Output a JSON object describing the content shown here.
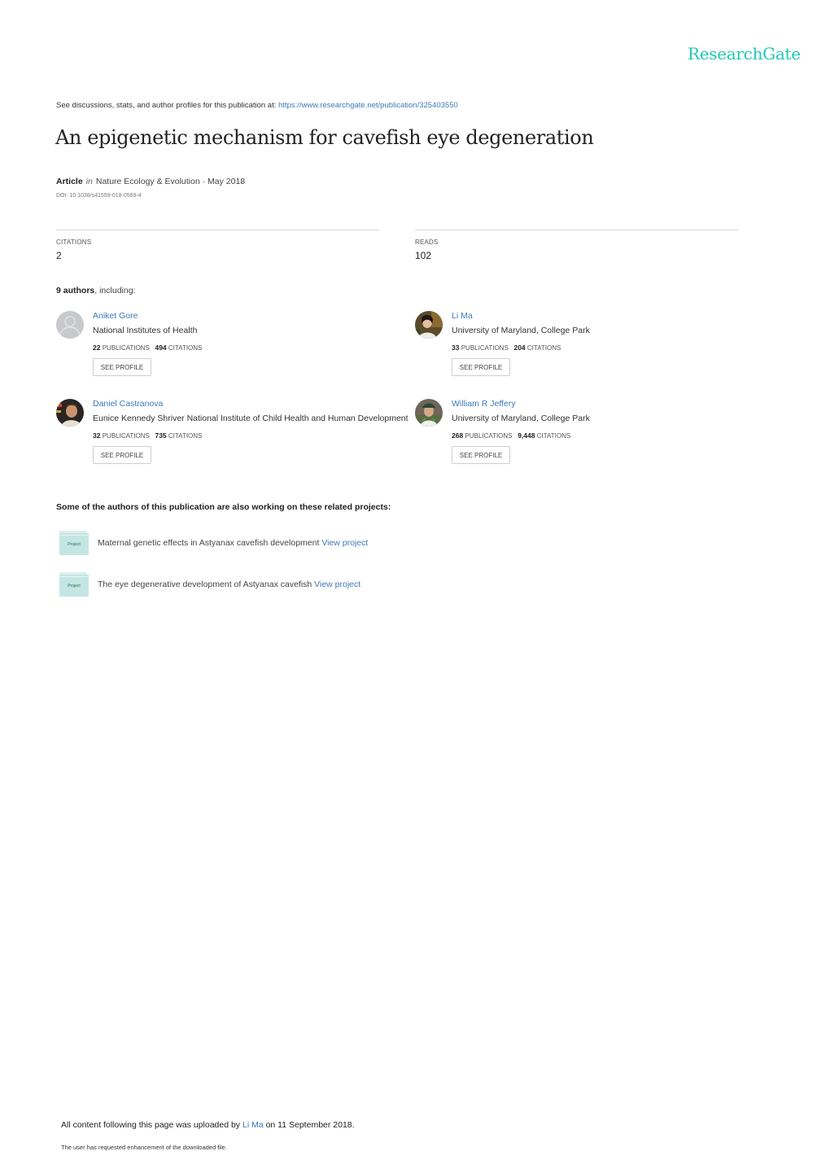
{
  "brand": {
    "logo_text": "ResearchGate",
    "accent_color": "#1ec8b4",
    "link_color": "#3d7ab8"
  },
  "header": {
    "discuss_prefix": "See discussions, stats, and author profiles for this publication at: ",
    "discuss_url": "https://www.researchgate.net/publication/325403550"
  },
  "publication": {
    "title": "An epigenetic mechanism for cavefish eye degeneration",
    "type": "Article",
    "in_word": "in",
    "journal_date": "Nature Ecology & Evolution · May 2018",
    "doi": "DOI: 10.1038/s41559-018-0569-4"
  },
  "stats": {
    "citations_label": "CITATIONS",
    "citations_value": "2",
    "reads_label": "READS",
    "reads_value": "102"
  },
  "authors_section": {
    "count_bold": "9 authors",
    "count_rest": ", including:"
  },
  "authors": [
    {
      "name": "Aniket Gore",
      "institution": "National Institutes of Health",
      "publications": "22",
      "publications_label": "PUBLICATIONS",
      "citations": "494",
      "citations_label": "CITATIONS",
      "button": "SEE PROFILE",
      "avatar": "placeholder-avatar"
    },
    {
      "name": "Li Ma",
      "institution": "University of Maryland, College Park",
      "publications": "33",
      "publications_label": "PUBLICATIONS",
      "citations": "204",
      "citations_label": "CITATIONS",
      "button": "SEE PROFILE",
      "avatar": "photo-avatar"
    },
    {
      "name": "Daniel Castranova",
      "institution": "Eunice Kennedy Shriver National Institute of Child Health and Human Development",
      "publications": "32",
      "publications_label": "PUBLICATIONS",
      "citations": "735",
      "citations_label": "CITATIONS",
      "button": "SEE PROFILE",
      "avatar": "photo-avatar"
    },
    {
      "name": "William R Jeffery",
      "institution": "University of Maryland, College Park",
      "publications": "268",
      "publications_label": "PUBLICATIONS",
      "citations": "9,448",
      "citations_label": "CITATIONS",
      "button": "SEE PROFILE",
      "avatar": "photo-avatar"
    }
  ],
  "related": {
    "heading": "Some of the authors of this publication are also working on these related projects:",
    "projects": [
      {
        "icon_label": "Project",
        "title": "Maternal genetic effects in Astyanax cavefish development",
        "link": "View project"
      },
      {
        "icon_label": "Project",
        "title": "The eye degenerative development of Astyanax cavefish",
        "link": "View project"
      }
    ]
  },
  "footer": {
    "upload_prefix": "All content following this page was uploaded by ",
    "uploader": "Li Ma",
    "upload_suffix": " on 11 September 2018.",
    "note": "The user has requested enhancement of the downloaded file."
  }
}
